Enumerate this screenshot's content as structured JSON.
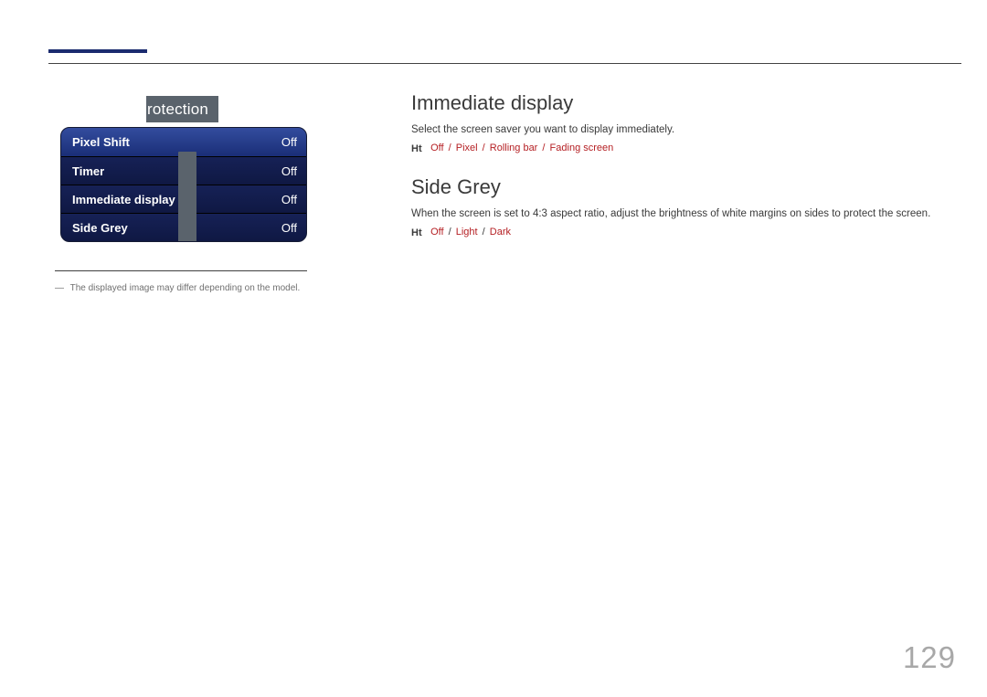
{
  "accent": "#1b2b6f",
  "menu": {
    "title": "rotection",
    "rows": [
      {
        "label": "Pixel Shift",
        "value": "Off"
      },
      {
        "label": "Timer",
        "value": "Off"
      },
      {
        "label": "Immediate display",
        "value": "Off"
      },
      {
        "label": "Side Grey",
        "value": "Off"
      }
    ]
  },
  "footnote": {
    "dash": "―",
    "text": "The displayed image may differ depending on the model."
  },
  "sections": {
    "immediate": {
      "heading": "Immediate display",
      "desc": "Select the screen saver you want to display immediately.",
      "ht": "Ht",
      "options": [
        "Off",
        "Pixel",
        "Rolling bar",
        "Fading screen"
      ]
    },
    "sidegrey": {
      "heading": "Side Grey",
      "desc": "When the screen is set to 4:3 aspect ratio, adjust the brightness of white margins on sides to protect the screen.",
      "ht": "Ht",
      "options": [
        "Off",
        "Light",
        "Dark"
      ]
    }
  },
  "page": "129"
}
